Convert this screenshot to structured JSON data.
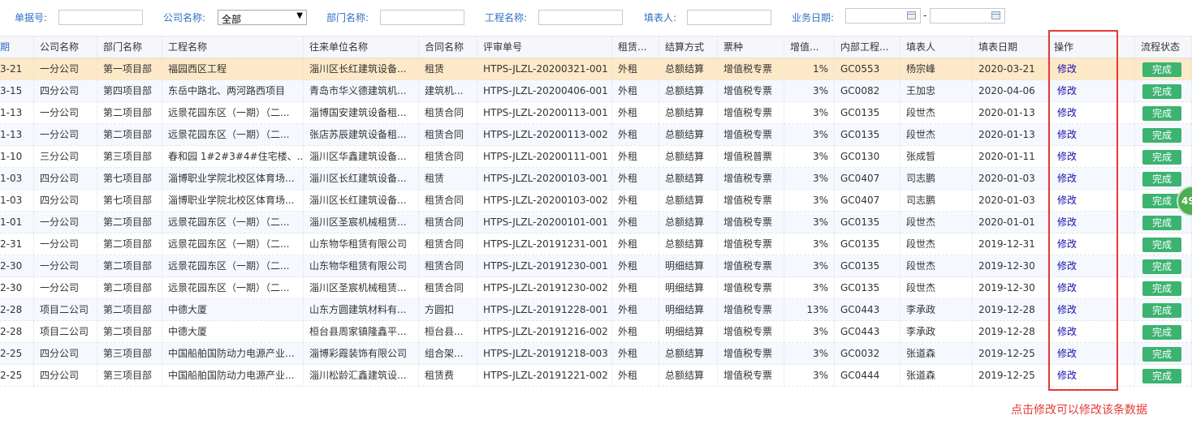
{
  "filters": {
    "doc_no_label": "单据号:",
    "company_label": "公司名称:",
    "company_value": "全部",
    "dept_label": "部门名称:",
    "project_label": "工程名称:",
    "filler_label": "填表人:",
    "biz_date_label": "业务日期:",
    "date_sep": "-"
  },
  "columns": [
    "期",
    "公司名称",
    "部门名称",
    "工程名称",
    "往来单位名称",
    "合同名称",
    "评审单号",
    "租赁...",
    "结算方式",
    "票种",
    "增值...",
    "内部工程...",
    "填表人",
    "填表日期",
    "操作",
    "流程状态"
  ],
  "rows": [
    [
      "3-21",
      "一分公司",
      "第一项目部",
      "福园西区工程",
      "淄川区长红建筑设备...",
      "租赁",
      "HTPS-JLZL-20200321-001",
      "外租",
      "总额结算",
      "增值税专票",
      "1%",
      "GC0553",
      "杨宗峰",
      "2020-03-21",
      "修改",
      "完成"
    ],
    [
      "3-15",
      "四分公司",
      "第四项目部",
      "东岳中路北、两河路西项目",
      "青岛市华义德建筑机...",
      "建筑机...",
      "HTPS-JLZL-20200406-001",
      "外租",
      "总额结算",
      "增值税专票",
      "3%",
      "GC0082",
      "王加忠",
      "2020-04-06",
      "修改",
      "完成"
    ],
    [
      "1-13",
      "一分公司",
      "第二项目部",
      "远景花园东区（一期）（二...",
      "淄博国安建筑设备租...",
      "租赁合同",
      "HTPS-JLZL-20200113-001",
      "外租",
      "总额结算",
      "增值税专票",
      "3%",
      "GC0135",
      "段世杰",
      "2020-01-13",
      "修改",
      "完成"
    ],
    [
      "1-13",
      "一分公司",
      "第二项目部",
      "远景花园东区（一期）（二...",
      "张店苏辰建筑设备租...",
      "租赁合同",
      "HTPS-JLZL-20200113-002",
      "外租",
      "总额结算",
      "增值税专票",
      "3%",
      "GC0135",
      "段世杰",
      "2020-01-13",
      "修改",
      "完成"
    ],
    [
      "1-10",
      "三分公司",
      "第三项目部",
      "春和园 1#2#3#4#住宅楼、...",
      "淄川区华鑫建筑设备...",
      "租赁合同",
      "HTPS-JLZL-20200111-001",
      "外租",
      "总额结算",
      "增值税普票",
      "3%",
      "GC0130",
      "张成晳",
      "2020-01-11",
      "修改",
      "完成"
    ],
    [
      "1-03",
      "四分公司",
      "第七项目部",
      "淄博职业学院北校区体育场...",
      "淄川区长红建筑设备...",
      "租赁",
      "HTPS-JLZL-20200103-001",
      "外租",
      "总额结算",
      "增值税专票",
      "3%",
      "GC0407",
      "司志鹏",
      "2020-01-03",
      "修改",
      "完成"
    ],
    [
      "1-03",
      "四分公司",
      "第七项目部",
      "淄博职业学院北校区体育场...",
      "淄川区长红建筑设备...",
      "租赁合同",
      "HTPS-JLZL-20200103-002",
      "外租",
      "总额结算",
      "增值税专票",
      "3%",
      "GC0407",
      "司志鹏",
      "2020-01-03",
      "修改",
      "完成"
    ],
    [
      "1-01",
      "一分公司",
      "第二项目部",
      "远景花园东区（一期）（二...",
      "淄川区圣宸机械租赁...",
      "租赁合同",
      "HTPS-JLZL-20200101-001",
      "外租",
      "总额结算",
      "增值税专票",
      "3%",
      "GC0135",
      "段世杰",
      "2020-01-01",
      "修改",
      "完成"
    ],
    [
      "2-31",
      "一分公司",
      "第二项目部",
      "远景花园东区（一期）（二...",
      "山东物华租赁有限公司",
      "租赁合同",
      "HTPS-JLZL-20191231-001",
      "外租",
      "总额结算",
      "增值税专票",
      "3%",
      "GC0135",
      "段世杰",
      "2019-12-31",
      "修改",
      "完成"
    ],
    [
      "2-30",
      "一分公司",
      "第二项目部",
      "远景花园东区（一期）（二...",
      "山东物华租赁有限公司",
      "租赁合同",
      "HTPS-JLZL-20191230-001",
      "外租",
      "明细结算",
      "增值税专票",
      "3%",
      "GC0135",
      "段世杰",
      "2019-12-30",
      "修改",
      "完成"
    ],
    [
      "2-30",
      "一分公司",
      "第二项目部",
      "远景花园东区（一期）（二...",
      "淄川区圣宸机械租赁...",
      "租赁合同",
      "HTPS-JLZL-20191230-002",
      "外租",
      "明细结算",
      "增值税专票",
      "3%",
      "GC0135",
      "段世杰",
      "2019-12-30",
      "修改",
      "完成"
    ],
    [
      "2-28",
      "项目二公司",
      "第二项目部",
      "中德大厦",
      "山东方圆建筑材料有...",
      "方圆扣",
      "HTPS-JLZL-20191228-001",
      "外租",
      "明细结算",
      "增值税专票",
      "13%",
      "GC0443",
      "李承政",
      "2019-12-28",
      "修改",
      "完成"
    ],
    [
      "2-28",
      "项目二公司",
      "第二项目部",
      "中德大厦",
      "桓台县周家镇隆鑫平...",
      "桓台县...",
      "HTPS-JLZL-20191216-002",
      "外租",
      "明细结算",
      "增值税专票",
      "3%",
      "GC0443",
      "李承政",
      "2019-12-28",
      "修改",
      "完成"
    ],
    [
      "2-25",
      "四分公司",
      "第三项目部",
      "中国船舶国防动力电源产业...",
      "淄博彩霞装饰有限公司",
      "组合架...",
      "HTPS-JLZL-20191218-003",
      "外租",
      "总额结算",
      "增值税专票",
      "3%",
      "GC0032",
      "张道森",
      "2019-12-25",
      "修改",
      "完成"
    ],
    [
      "2-25",
      "四分公司",
      "第三项目部",
      "中国船舶国防动力电源产业...",
      "淄川松龄汇鑫建筑设...",
      "租赁费",
      "HTPS-JLZL-20191221-002",
      "外租",
      "总额结算",
      "增值税专票",
      "3%",
      "GC0444",
      "张道森",
      "2019-12-25",
      "修改",
      "完成"
    ]
  ],
  "selected_row": 0,
  "hint_text": "点击修改可以修改该条数据",
  "float_badge": "49",
  "colors": {
    "highlight": "#e53935",
    "status_green": "#3cb371",
    "selected_row": "#fde9c8",
    "label_blue": "#2f6fc2"
  }
}
